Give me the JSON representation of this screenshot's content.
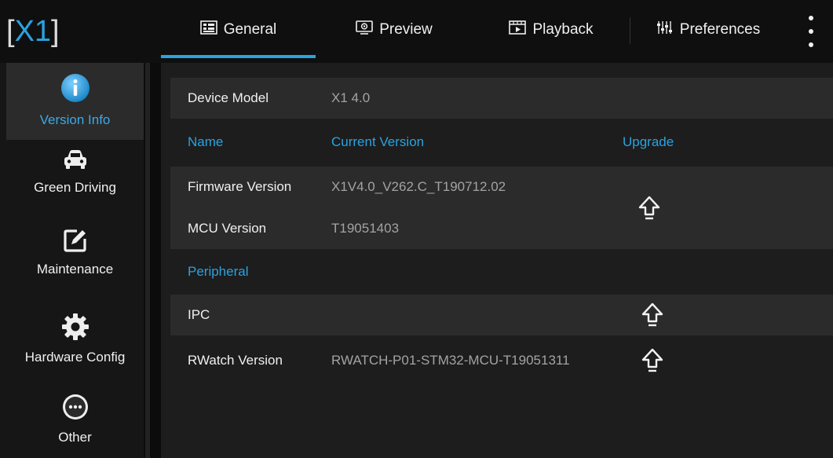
{
  "app": {
    "logo_text": "X1"
  },
  "tabs": [
    {
      "label": "General",
      "icon": "general-icon",
      "active": true
    },
    {
      "label": "Preview",
      "icon": "preview-icon",
      "active": false
    },
    {
      "label": "Playback",
      "icon": "playback-icon",
      "active": false
    },
    {
      "label": "Preferences",
      "icon": "preferences-icon",
      "active": false
    }
  ],
  "sidebar": {
    "items": [
      {
        "label": "Version Info",
        "icon": "info-icon",
        "active": true
      },
      {
        "label": "Green Driving",
        "icon": "car-icon",
        "active": false
      },
      {
        "label": "Maintenance",
        "icon": "edit-icon",
        "active": false
      },
      {
        "label": "Hardware Config",
        "icon": "gear-icon",
        "active": false
      },
      {
        "label": "Other",
        "icon": "more-icon",
        "active": false
      }
    ]
  },
  "device": {
    "label": "Device Model",
    "value": "X1 4.0"
  },
  "table": {
    "headers": {
      "name": "Name",
      "current": "Current Version",
      "upgrade": "Upgrade"
    },
    "firmware": {
      "label": "Firmware Version",
      "value": "X1V4.0_V262.C_T190712.02"
    },
    "mcu": {
      "label": "MCU Version",
      "value": "T19051403"
    },
    "peripheral_header": "Peripheral",
    "ipc": {
      "label": "IPC",
      "value": ""
    },
    "rwatch": {
      "label": "RWatch Version",
      "value": "RWATCH-P01-STM32-MCU-T19051311"
    }
  },
  "colors": {
    "accent": "#2aa3e0",
    "background": "#1a1a1a",
    "row": "#2b2b2b"
  }
}
